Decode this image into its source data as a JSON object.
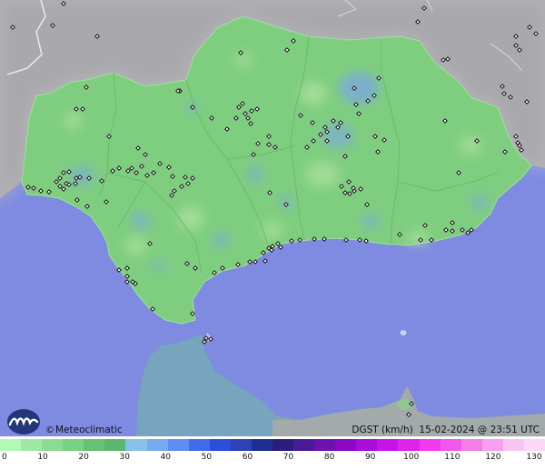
{
  "map": {
    "sea_color": "#7f8be0",
    "land_color": "#7fce7f",
    "foreign_land_color": "#a9a9ad",
    "station_symbol": "small-diamond",
    "stations": [
      [
        14,
        30
      ],
      [
        58,
        28
      ],
      [
        70,
        4
      ],
      [
        107,
        40
      ],
      [
        84,
        120
      ],
      [
        95,
        96
      ],
      [
        91,
        120
      ],
      [
        120,
        150
      ],
      [
        152,
        163
      ],
      [
        156,
        183
      ],
      [
        160,
        170
      ],
      [
        162,
        193
      ],
      [
        169,
        190
      ],
      [
        176,
        180
      ],
      [
        186,
        184
      ],
      [
        190,
        194
      ],
      [
        150,
        190
      ],
      [
        145,
        185
      ],
      [
        131,
        185
      ],
      [
        141,
        188
      ],
      [
        124,
        188
      ],
      [
        112,
        199
      ],
      [
        117,
        222
      ],
      [
        98,
        196
      ],
      [
        88,
        195
      ],
      [
        84,
        196
      ],
      [
        83,
        202
      ],
      [
        73,
        202
      ],
      [
        70,
        190
      ],
      [
        70,
        208
      ],
      [
        62,
        200
      ],
      [
        66,
        196
      ],
      [
        76,
        189
      ],
      [
        76,
        203
      ],
      [
        66,
        205
      ],
      [
        54,
        211
      ],
      [
        45,
        210
      ],
      [
        37,
        207
      ],
      [
        31,
        206
      ],
      [
        96,
        227
      ],
      [
        85,
        220
      ],
      [
        189,
        215
      ],
      [
        192,
        210
      ],
      [
        200,
        205
      ],
      [
        207,
        202
      ],
      [
        212,
        196
      ],
      [
        204,
        195
      ],
      [
        198,
        100
      ],
      [
        196,
        100
      ],
      [
        212,
        118
      ],
      [
        233,
        130
      ],
      [
        260,
        130
      ],
      [
        263,
        118
      ],
      [
        267,
        114
      ],
      [
        270,
        125
      ],
      [
        277,
        122
      ],
      [
        283,
        120
      ],
      [
        276,
        136
      ],
      [
        273,
        130
      ],
      [
        250,
        142
      ],
      [
        265,
        58
      ],
      [
        323,
        45
      ],
      [
        316,
        55
      ],
      [
        390,
        97
      ],
      [
        412,
        105
      ],
      [
        392,
        115
      ],
      [
        395,
        125
      ],
      [
        405,
        111
      ],
      [
        417,
        86
      ],
      [
        423,
        154
      ],
      [
        413,
        150
      ],
      [
        383,
        150
      ],
      [
        372,
        140
      ],
      [
        375,
        135
      ],
      [
        367,
        133
      ],
      [
        360,
        145
      ],
      [
        358,
        140
      ],
      [
        353,
        148
      ],
      [
        360,
        155
      ],
      [
        380,
        172
      ],
      [
        384,
        200
      ],
      [
        376,
        205
      ],
      [
        380,
        212
      ],
      [
        385,
        213
      ],
      [
        390,
        210
      ],
      [
        389,
        207
      ],
      [
        397,
        208
      ],
      [
        404,
        225
      ],
      [
        416,
        167
      ],
      [
        505,
        190
      ],
      [
        490,
        133
      ],
      [
        525,
        155
      ],
      [
        468,
        248
      ],
      [
        498,
        245
      ],
      [
        509,
        253
      ],
      [
        519,
        253
      ],
      [
        515,
        256
      ],
      [
        498,
        254
      ],
      [
        491,
        253
      ],
      [
        475,
        264
      ],
      [
        463,
        264
      ],
      [
        440,
        258
      ],
      [
        403,
        265
      ],
      [
        396,
        264
      ],
      [
        381,
        264
      ],
      [
        357,
        263
      ],
      [
        346,
        263
      ],
      [
        330,
        264
      ],
      [
        321,
        265
      ],
      [
        306,
        268
      ],
      [
        309,
        272
      ],
      [
        300,
        271
      ],
      [
        299,
        275
      ],
      [
        296,
        273
      ],
      [
        290,
        278
      ],
      [
        292,
        287
      ],
      [
        281,
        288
      ],
      [
        275,
        288
      ],
      [
        262,
        291
      ],
      [
        245,
        295
      ],
      [
        236,
        300
      ],
      [
        215,
        295
      ],
      [
        206,
        290
      ],
      [
        165,
        268
      ],
      [
        140,
        295
      ],
      [
        140,
        304
      ],
      [
        131,
        297
      ],
      [
        140,
        310
      ],
      [
        149,
        312
      ],
      [
        146,
        310
      ],
      [
        168,
        340
      ],
      [
        212,
        345
      ],
      [
        225,
        376
      ],
      [
        227,
        372
      ],
      [
        232,
        373
      ],
      [
        297,
        212
      ],
      [
        315,
        225
      ],
      [
        279,
        170
      ],
      [
        284,
        158
      ],
      [
        296,
        150
      ],
      [
        303,
        162
      ],
      [
        296,
        159
      ],
      [
        331,
        127
      ],
      [
        344,
        135
      ],
      [
        338,
        162
      ],
      [
        345,
        155
      ],
      [
        568,
        40
      ],
      [
        568,
        50
      ],
      [
        572,
        55
      ],
      [
        553,
        95
      ],
      [
        555,
        103
      ],
      [
        562,
        107
      ],
      [
        580,
        112
      ],
      [
        568,
        150
      ],
      [
        572,
        160
      ],
      [
        574,
        165
      ],
      [
        570,
        157
      ],
      [
        556,
        167
      ],
      [
        488,
        66
      ],
      [
        493,
        65
      ],
      [
        467,
        9
      ],
      [
        460,
        24
      ],
      [
        583,
        30
      ],
      [
        590,
        37
      ],
      [
        453,
        444
      ],
      [
        450,
        456
      ]
    ]
  },
  "branding": {
    "copyright_symbol": "©",
    "source": "Meteoclimatic",
    "logo_icon": "meteoclimatic-logo-icon"
  },
  "header": {
    "variable": "DGST (km/h)",
    "timestamp": "15-02-2024 @ 23:51 UTC"
  },
  "legend": {
    "title": "",
    "ticks": [
      "0",
      "10",
      "20",
      "30",
      "40",
      "50",
      "60",
      "70",
      "80",
      "90",
      "100",
      "110",
      "120",
      "130"
    ],
    "colors": [
      "#b2f8b6",
      "#9ee8a4",
      "#8bdc92",
      "#78d082",
      "#66c273",
      "#5bb670",
      "#88c0ea",
      "#78aaf0",
      "#5e8ef2",
      "#3f6ae8",
      "#2d4ed8",
      "#2e42b6",
      "#1e2f94",
      "#2a1d7e",
      "#4a1b96",
      "#6b12b0",
      "#8a08c4",
      "#a80cd8",
      "#c415e6",
      "#de24e8",
      "#ee3cee",
      "#f257ec",
      "#f67ce8",
      "#f8a0ee",
      "#fac4f2",
      "#fcd8f6"
    ]
  }
}
